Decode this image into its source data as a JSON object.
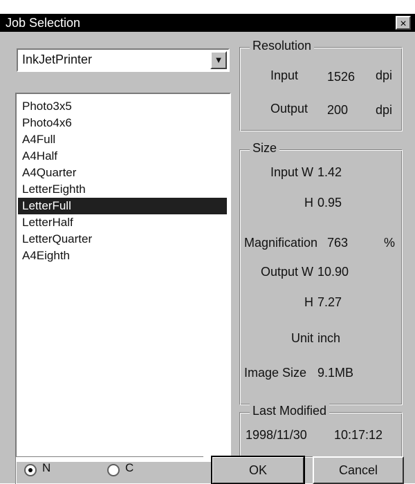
{
  "window": {
    "title": "Job Selection",
    "close_glyph": "×"
  },
  "printer_select": {
    "value": "InkJetPrinter",
    "arrow_glyph": "▼"
  },
  "job_list": {
    "items": [
      "Photo3x5",
      "Photo4x6",
      "A4Full",
      "A4Half",
      "A4Quarter",
      "LetterEighth",
      "LetterFull",
      "LetterHalf",
      "LetterQuarter",
      "A4Eighth"
    ],
    "selected": "LetterFull"
  },
  "resolution": {
    "legend": "Resolution",
    "input_label": "Input",
    "input_value": "1526",
    "input_unit": "dpi",
    "output_label": "Output",
    "output_value": "200",
    "output_unit": "dpi"
  },
  "size": {
    "legend": "Size",
    "input_w_label": "Input W",
    "input_w_value": "1.42",
    "input_h_label": "H",
    "input_h_value": "0.95",
    "magnification_label": "Magnification",
    "magnification_value": "763",
    "magnification_unit": "%",
    "output_w_label": "Output W",
    "output_w_value": "10.90",
    "output_h_label": "H",
    "output_h_value": "7.27",
    "unit_label": "Unit",
    "unit_value": "inch",
    "image_size_label": "Image Size",
    "image_size_value": "9.1MB"
  },
  "last_modified": {
    "legend": "Last Modified",
    "date": "1998/11/30",
    "time": "10:17:12"
  },
  "bottom": {
    "radio1_label": "N",
    "radio2_label": "C",
    "ok_label": "OK",
    "cancel_label": "Cancel"
  },
  "colors": {
    "face": "#c0c0c0",
    "titlebar": "#000000",
    "selection": "#202020"
  }
}
